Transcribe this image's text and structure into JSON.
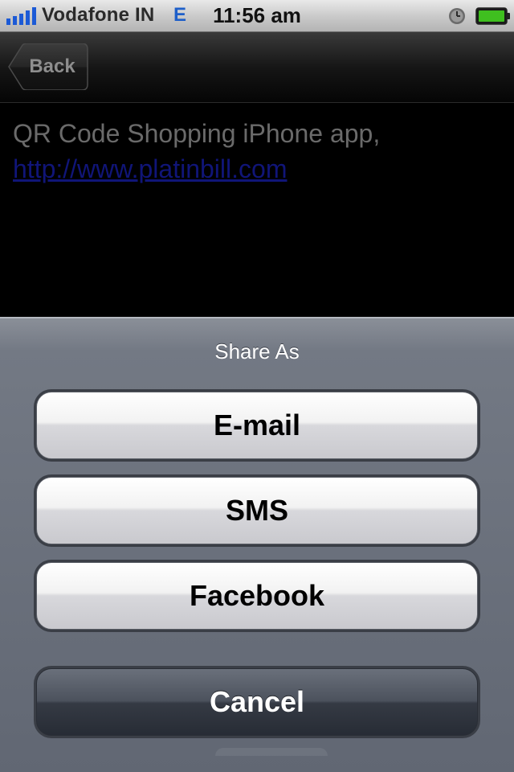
{
  "status_bar": {
    "carrier": "Vodafone IN",
    "network": "E",
    "time": "11:56 am"
  },
  "nav_bar": {
    "back_label": "Back"
  },
  "content": {
    "text": "QR Code Shopping iPhone app,",
    "link": "http://www.platinbill.com"
  },
  "action_sheet": {
    "title": "Share As",
    "buttons": [
      {
        "label": "E-mail"
      },
      {
        "label": "SMS"
      },
      {
        "label": "Facebook"
      }
    ],
    "cancel_label": "Cancel"
  },
  "icons": {
    "signal": "signal-bars-icon",
    "alarm": "alarm-clock-icon",
    "battery": "battery-icon"
  },
  "colors": {
    "link": "#101578",
    "network": "#1e5fc9",
    "battery_fill": "#3fbf1f"
  }
}
